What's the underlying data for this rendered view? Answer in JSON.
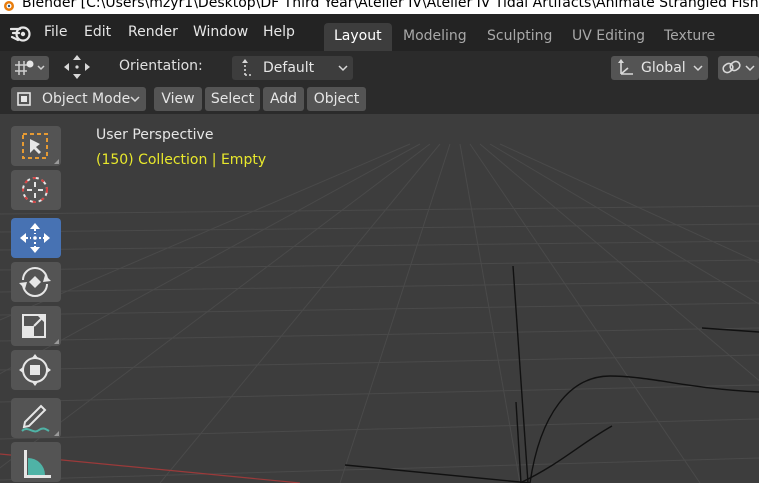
{
  "window": {
    "title": "Blender [C:\\Users\\mzyr1\\Desktop\\DF Third Year\\Atelier IV\\Atelier IV Tidal Artifacts\\Animate Strangled Fish and T"
  },
  "menu": {
    "items": [
      "File",
      "Edit",
      "Render",
      "Window",
      "Help"
    ]
  },
  "workspaces": {
    "tabs": [
      "Layout",
      "Modeling",
      "Sculpting",
      "UV Editing",
      "Texture Paint"
    ],
    "active": "Layout"
  },
  "header": {
    "orientation_label": "Orientation:",
    "orientation_value": "Default",
    "transform_space": "Global"
  },
  "viewport_header": {
    "mode": "Object Mode",
    "menus": [
      "View",
      "Select",
      "Add",
      "Object"
    ]
  },
  "viewport": {
    "perspective": "User Perspective",
    "collection_info": "(150) Collection | Empty"
  },
  "toolbar": {
    "tools": [
      "select-box-icon",
      "cursor-icon",
      "move-icon",
      "rotate-icon",
      "scale-icon",
      "transform-icon",
      "annotate-icon",
      "measure-icon"
    ],
    "active": "move-icon"
  },
  "colors": {
    "accent": "#4772b3",
    "collection_text": "#e8e82c",
    "background": "#3d3d3d",
    "header": "#2b2b2b",
    "select_icon": "#e69a33"
  }
}
